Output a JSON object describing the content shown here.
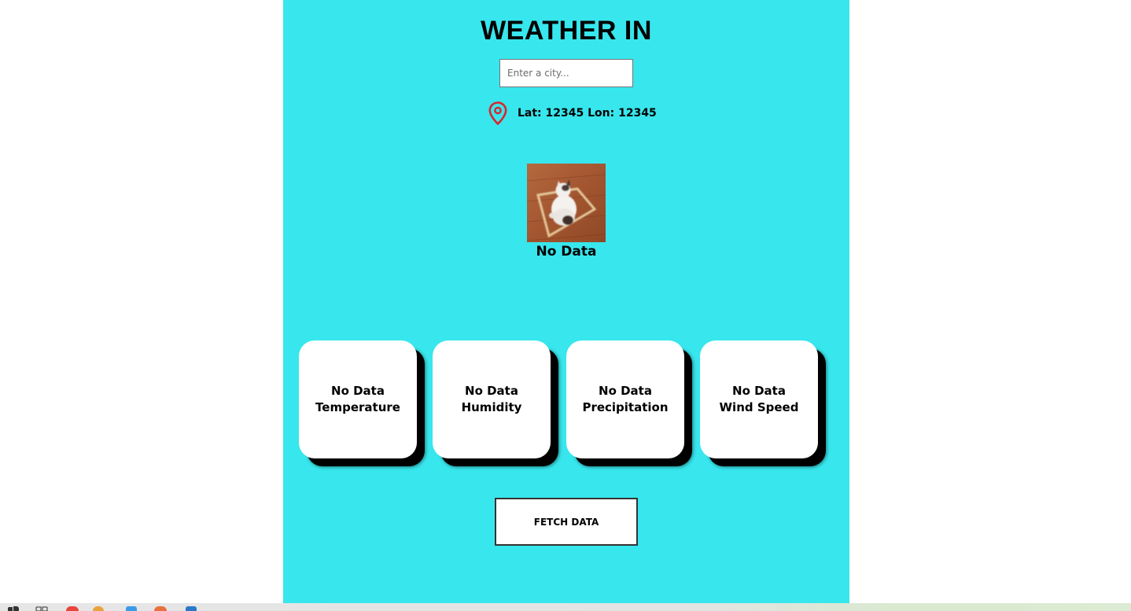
{
  "header": {
    "title": "WEATHER IN"
  },
  "search": {
    "placeholder": "Enter a city...",
    "value": ""
  },
  "location": {
    "icon": "map-pin-icon",
    "coords_text": "Lat: 12345 Lon: 12345"
  },
  "condition": {
    "image": "cat-in-box-photo",
    "text": "No Data"
  },
  "cards": [
    {
      "value": "No Data",
      "label": "Temperature"
    },
    {
      "value": "No Data",
      "label": "Humidity"
    },
    {
      "value": "No Data",
      "label": "Precipitation"
    },
    {
      "value": "No Data",
      "label": "Wind Speed"
    }
  ],
  "actions": {
    "fetch_label": "FETCH DATA"
  },
  "colors": {
    "panel_background": "#38e6ed",
    "pin_icon": "#d9262c",
    "card_background": "#ffffff",
    "card_shadow": "#000000"
  },
  "taskbar": {
    "icons": [
      "windows-start-icon",
      "task-view-icon",
      "chrome-icon",
      "app-icon",
      "file-explorer-icon",
      "browser-icon",
      "vscode-icon"
    ]
  }
}
